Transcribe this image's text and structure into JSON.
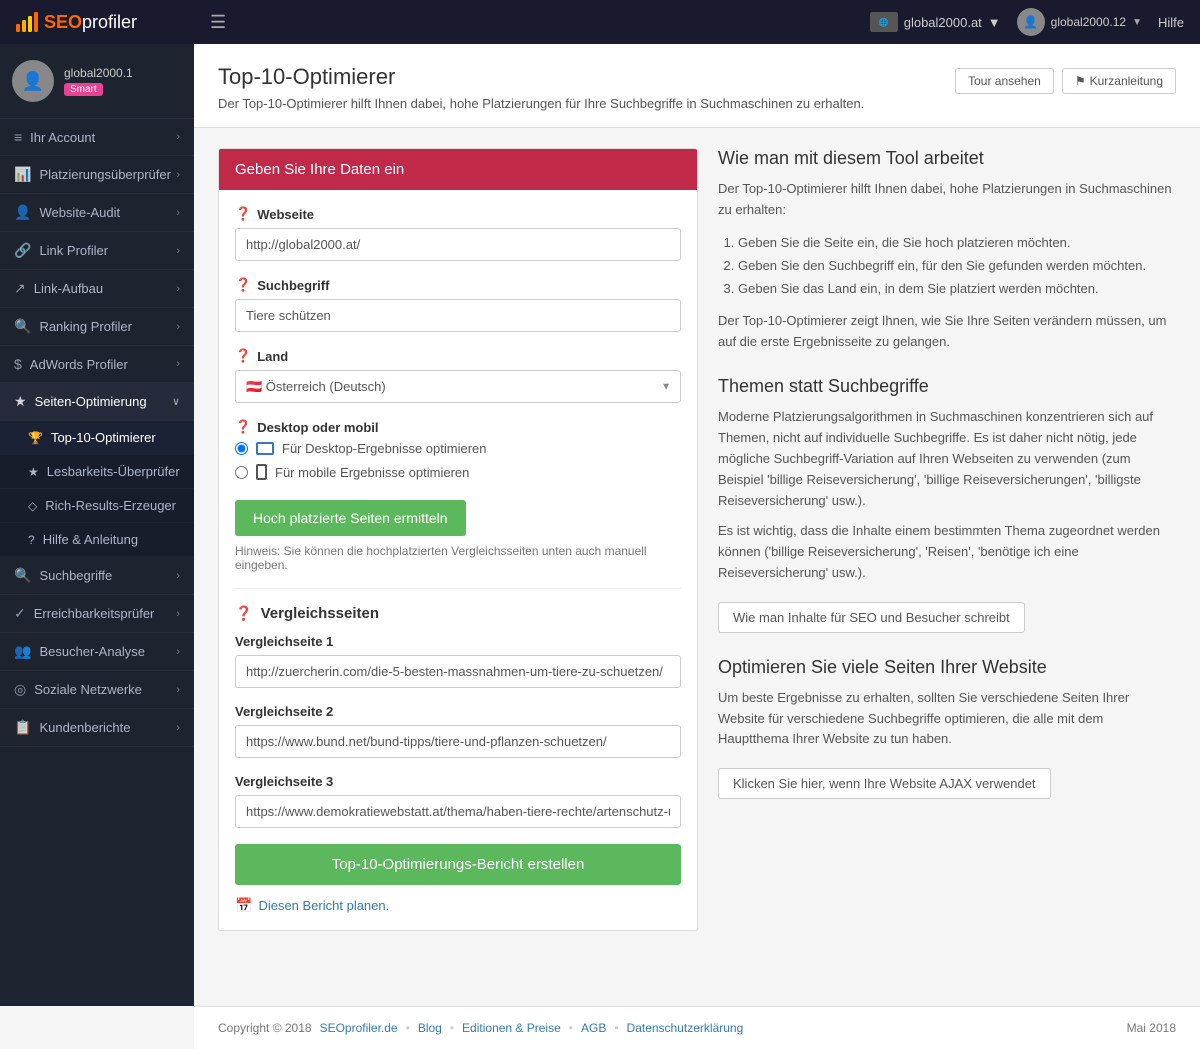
{
  "topnav": {
    "logo_text": "SEOprofiler",
    "logo_text_seo": "SEO",
    "logo_text_profiler": "profiler",
    "menu_icon": "☰",
    "site_name": "global2000.at",
    "user_name": "global2000.12",
    "help_label": "Hilfe"
  },
  "sidebar": {
    "username": "global2000.1",
    "badge": "Smart",
    "items": [
      {
        "id": "ihr-account",
        "label": "Ihr Account",
        "icon": "≡",
        "has_arrow": true
      },
      {
        "id": "platzierungsuberprüfer",
        "label": "Platzierungsüberprüfer",
        "icon": "📊",
        "has_arrow": true
      },
      {
        "id": "website-audit",
        "label": "Website-Audit",
        "icon": "👤",
        "has_arrow": true
      },
      {
        "id": "link-profiler",
        "label": "Link Profiler",
        "icon": "🔗",
        "has_arrow": true
      },
      {
        "id": "link-aufbau",
        "label": "Link-Aufbau",
        "icon": "↗",
        "has_arrow": true
      },
      {
        "id": "ranking-profiler",
        "label": "Ranking Profiler",
        "icon": "🔍",
        "has_arrow": true
      },
      {
        "id": "adwords-profiler",
        "label": "AdWords Profiler",
        "icon": "$",
        "has_arrow": true
      },
      {
        "id": "seiten-optimierung",
        "label": "Seiten-Optimierung",
        "icon": "★",
        "has_arrow": true,
        "active": true
      },
      {
        "id": "top10-optimierer",
        "label": "Top-10-Optimierer",
        "icon": "🏆",
        "sub": true,
        "active": true
      },
      {
        "id": "lesbarkeits-uberprüfer",
        "label": "Lesbarkeits-Überprüfer",
        "icon": "★",
        "sub": true
      },
      {
        "id": "rich-results-erzeuger",
        "label": "Rich-Results-Erzeuger",
        "icon": "◇",
        "sub": true
      },
      {
        "id": "hilfe-anleitung",
        "label": "Hilfe & Anleitung",
        "icon": "?",
        "sub": true
      },
      {
        "id": "suchbegriffe",
        "label": "Suchbegriffe",
        "icon": "🔍",
        "has_arrow": true
      },
      {
        "id": "erreichbarkeitsprufer",
        "label": "Erreichbarkeitsprüfer",
        "icon": "✓",
        "has_arrow": true
      },
      {
        "id": "besucher-analyse",
        "label": "Besucher-Analyse",
        "icon": "👥",
        "has_arrow": true
      },
      {
        "id": "soziale-netzwerke",
        "label": "Soziale Netzwerke",
        "icon": "◎",
        "has_arrow": true
      },
      {
        "id": "kundenberichte",
        "label": "Kundenberichte",
        "icon": "📋",
        "has_arrow": true
      }
    ]
  },
  "header": {
    "title": "Top-10-Optimierer",
    "subtitle": "Der Top-10-Optimierer hilft Ihnen dabei, hohe Platzierungen für Ihre Suchbegriffe in Suchmaschinen zu erhalten.",
    "btn_tour": "Tour ansehen",
    "btn_guide": "Kurzanleitung"
  },
  "form": {
    "card_header": "Geben Sie Ihre Daten ein",
    "website_label": "Webseite",
    "website_value": "http://global2000.at/",
    "website_placeholder": "http://global2000.at/",
    "suchbegriff_label": "Suchbegriff",
    "suchbegriff_value": "Tiere schützen",
    "suchbegriff_placeholder": "Tiere schützen",
    "land_label": "Land",
    "land_value": "Österreich (Deutsch)",
    "desktop_label": "Desktop oder mobil",
    "desktop_option": "Für Desktop-Ergebnisse optimieren",
    "mobile_option": "Für mobile Ergebnisse optimieren",
    "btn_hoch": "Hoch platzierte Seiten ermitteln",
    "hinweis": "Hinweis: Sie können die hochplatzierten Vergleichsseiten unten auch manuell eingeben.",
    "vergleich_title": "Vergleichsseiten",
    "vergleich1_label": "Vergleichseite 1",
    "vergleich1_value": "http://zuercherin.com/die-5-besten-massnahmen-um-tiere-zu-schuetzen/",
    "vergleich2_label": "Vergleichseite 2",
    "vergleich2_value": "https://www.bund.net/bund-tipps/tiere-und-pflanzen-schuetzen/",
    "vergleich3_label": "Vergleichseite 3",
    "vergleich3_value": "https://www.demokratiewebstatt.at/thema/haben-tiere-rechte/artenschutz-und-arter",
    "btn_bericht": "Top-10-Optimierungs-Bericht erstellen",
    "schedule_link": "Diesen Bericht planen."
  },
  "info_panel": {
    "section1_title": "Wie man mit diesem Tool arbeitet",
    "section1_text": "Der Top-10-Optimierer hilft Ihnen dabei, hohe Platzierungen in Suchmaschinen zu erhalten:",
    "section1_list": [
      "Geben Sie die Seite ein, die Sie hoch platzieren möchten.",
      "Geben Sie den Suchbegriff ein, für den Sie gefunden werden möchten.",
      "Geben Sie das Land ein, in dem Sie platziert werden möchten."
    ],
    "section1_text2": "Der Top-10-Optimierer zeigt Ihnen, wie Sie Ihre Seiten verändern müssen, um auf die erste Ergebnisseite zu gelangen.",
    "section2_title": "Themen statt Suchbegriffe",
    "section2_text1": "Moderne Platzierungsalgorithmen in Suchmaschinen konzentrieren sich auf Themen, nicht auf individuelle Suchbegriffe. Es ist daher nicht nötig, jede mögliche Suchbegriff-Variation auf Ihren Webseiten zu verwenden (zum Beispiel 'billige Reiseversicherung', 'billige Reiseversicherungen', 'billigste Reiseversicherung' usw.).",
    "section2_text2": "Es ist wichtig, dass die Inhalte einem bestimmten Thema zugeordnet werden können ('billige Reiseversicherung', 'Reisen', 'benötige ich eine Reiseversicherung' usw.).",
    "section2_btn": "Wie man Inhalte für SEO und Besucher schreibt",
    "section3_title": "Optimieren Sie viele Seiten Ihrer Website",
    "section3_text": "Um beste Ergebnisse zu erhalten, sollten Sie verschiedene Seiten Ihrer Website für verschiedene Suchbegriffe optimieren, die alle mit dem Hauptthema Ihrer Website zu tun haben.",
    "section3_btn": "Klicken Sie hier, wenn Ihre Website AJAX verwendet"
  },
  "footer": {
    "copyright": "Copyright © 2018",
    "site_link": "SEOprofiler.de",
    "blog_link": "Blog",
    "editions_link": "Editionen & Preise",
    "agb_link": "AGB",
    "datenschutz_link": "Datenschutzerklärung",
    "date": "Mai 2018"
  }
}
